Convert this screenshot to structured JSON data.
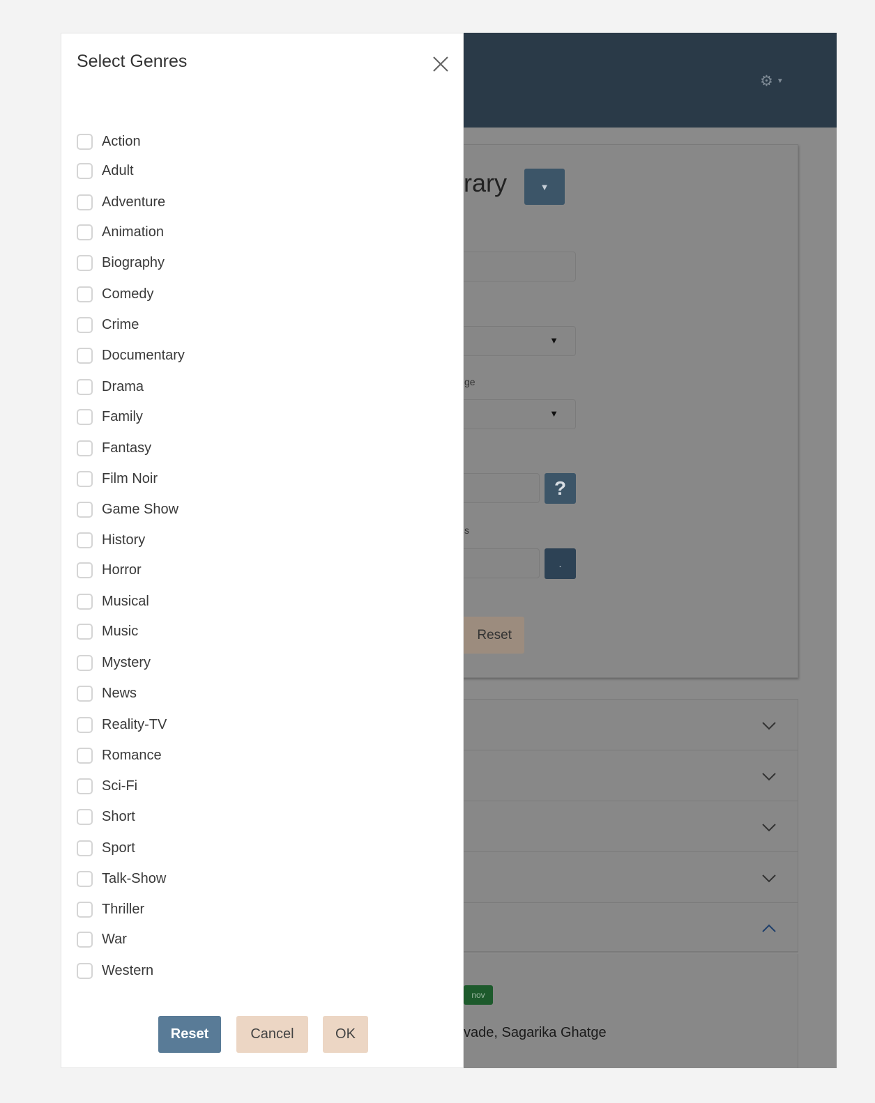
{
  "modal": {
    "title": "Select Genres",
    "genres": [
      {
        "label": "Action",
        "checked": false
      },
      {
        "label": "Adult",
        "checked": false
      },
      {
        "label": "Adventure",
        "checked": false
      },
      {
        "label": "Animation",
        "checked": false
      },
      {
        "label": "Biography",
        "checked": false
      },
      {
        "label": "Comedy",
        "checked": false
      },
      {
        "label": "Crime",
        "checked": false
      },
      {
        "label": "Documentary",
        "checked": false
      },
      {
        "label": "Drama",
        "checked": false
      },
      {
        "label": "Family",
        "checked": false
      },
      {
        "label": "Fantasy",
        "checked": false
      },
      {
        "label": "Film Noir",
        "checked": false
      },
      {
        "label": "Game Show",
        "checked": false
      },
      {
        "label": "History",
        "checked": false
      },
      {
        "label": "Horror",
        "checked": false
      },
      {
        "label": "Musical",
        "checked": false
      },
      {
        "label": "Music",
        "checked": false
      },
      {
        "label": "Mystery",
        "checked": false
      },
      {
        "label": "News",
        "checked": false
      },
      {
        "label": "Reality-TV",
        "checked": false
      },
      {
        "label": "Romance",
        "checked": false
      },
      {
        "label": "Sci-Fi",
        "checked": false
      },
      {
        "label": "Short",
        "checked": false
      },
      {
        "label": "Sport",
        "checked": false
      },
      {
        "label": "Talk-Show",
        "checked": false
      },
      {
        "label": "Thriller",
        "checked": false
      },
      {
        "label": "War",
        "checked": false
      },
      {
        "label": "Western",
        "checked": false
      }
    ],
    "buttons": {
      "reset": "Reset",
      "cancel": "Cancel",
      "ok": "OK"
    }
  },
  "background": {
    "title_fragment": "rary",
    "label_fragment_a": "ge",
    "label_fragment_b": "s",
    "help_label": "?",
    "dots_label": ".",
    "reset_label": "Reset",
    "badge_fragment": "nov",
    "cast_fragment": "vade, Sagarika Ghatge",
    "accordion_rows": 5
  },
  "colors": {
    "header": "#2a3a48",
    "overlay_background": "#8a8a8a",
    "primary_button": "#597b97",
    "secondary_button": "#ecd6c4",
    "badge": "#1d5a2c"
  },
  "icons": {
    "close": "close-icon",
    "settings": "gear-icon",
    "chevron_down": "chevron-down-icon",
    "chevron_up": "chevron-up-icon"
  }
}
